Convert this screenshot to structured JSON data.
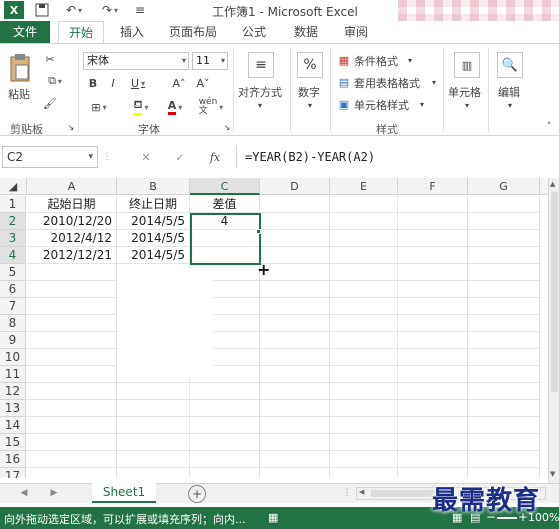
{
  "title": "工作簿1 - Microsoft Excel",
  "tabs": [
    {
      "label": "文件"
    },
    {
      "label": "开始"
    },
    {
      "label": "插入"
    },
    {
      "label": "页面布局"
    },
    {
      "label": "公式"
    },
    {
      "label": "数据"
    },
    {
      "label": "审阅"
    }
  ],
  "ribbon": {
    "paste_label": "粘贴",
    "font_name": "宋体",
    "font_size": "11",
    "alignment_label": "对齐方式",
    "number_label": "数字",
    "conditional_format": "条件格式",
    "table_format": "套用表格格式",
    "cell_styles": "单元格样式",
    "cells_label": "单元格",
    "edit_label": "编辑",
    "groups": {
      "clipboard": "剪贴板",
      "font": "字体",
      "styles": "样式"
    }
  },
  "formula_bar": {
    "name_box": "C2",
    "fx": "fx",
    "formula": "=YEAR(B2)-YEAR(A2)"
  },
  "columns": [
    "A",
    "B",
    "C",
    "D",
    "E",
    "F",
    "G"
  ],
  "rows": [
    "1",
    "2",
    "3",
    "4",
    "5",
    "6",
    "7",
    "8",
    "9",
    "10",
    "11",
    "12",
    "13",
    "14",
    "15",
    "16",
    "17"
  ],
  "cells": {
    "A1": "起始日期",
    "B1": "终止日期",
    "C1": "差值",
    "A2": "2010/12/20",
    "B2": "2014/5/5",
    "C2": "4",
    "A3": "2012/4/12",
    "B3": "2014/5/5",
    "A4": "2012/12/21",
    "B4": "2014/5/5"
  },
  "sheet_tab": "Sheet1",
  "status_text": "向外拖动选定区域，可以扩展或填充序列；向内...",
  "zoom": "100%",
  "watermark": "最需教育",
  "colors": {
    "accent": "#217346",
    "title_blur": "#f1d7de"
  }
}
